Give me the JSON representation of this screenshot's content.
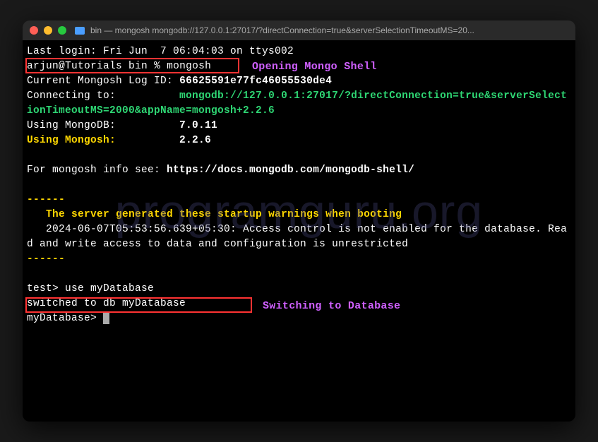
{
  "watermark": "programguru.org",
  "title": "bin — mongosh mongodb://127.0.0.1:27017/?directConnection=true&serverSelectionTimeoutMS=20...",
  "annotations": {
    "open_shell": "Opening Mongo Shell",
    "switch_db": "Switching to Database"
  },
  "lines": {
    "last_login": "Last login: Fri Jun  7 06:04:03 on ttys002",
    "prompt1_user": "arjun@Tutorials",
    "prompt1_dir": "bin",
    "prompt1_cmd": "mongosh",
    "log_id_label": "Current Mongosh Log ID:",
    "log_id_val": "66625591e77fc46055530de4",
    "connecting_label": "Connecting to:",
    "connecting_val": "mongodb://127.0.0.1:27017/?directConnection=true&serverSelectionTimeoutMS=2000&appName=mongosh+2.2.6",
    "using_mongodb_label": "Using MongoDB:",
    "using_mongodb_val": "7.0.11",
    "using_mongosh_label": "Using Mongosh:",
    "using_mongosh_val": "2.2.6",
    "docs_label": "For mongosh info see: ",
    "docs_url": "https://docs.mongodb.com/mongodb-shell/",
    "dash": "------",
    "warn_header": "The server generated these startup warnings when booting",
    "warn_body": "   2024-06-07T05:53:56.639+05:30: Access control is not enabled for the database. Read and write access to data and configuration is unrestricted",
    "test_prompt": "test>",
    "use_cmd": "use myDatabase",
    "switched": "switched to db myDatabase",
    "mydb_prompt": "myDatabase>"
  }
}
